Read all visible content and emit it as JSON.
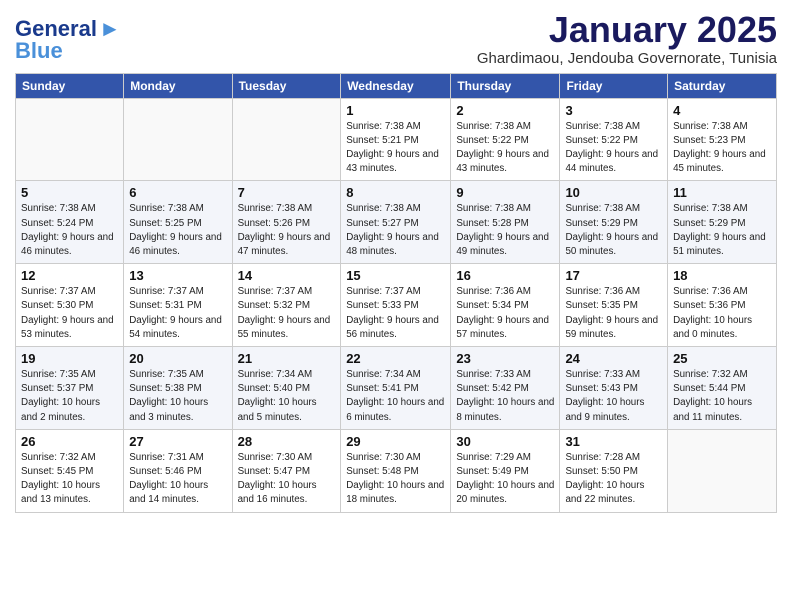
{
  "header": {
    "logo_line1": "General",
    "logo_line2": "Blue",
    "month": "January 2025",
    "location": "Ghardimaou, Jendouba Governorate, Tunisia"
  },
  "weekdays": [
    "Sunday",
    "Monday",
    "Tuesday",
    "Wednesday",
    "Thursday",
    "Friday",
    "Saturday"
  ],
  "weeks": [
    [
      {
        "day": "",
        "sunrise": "",
        "sunset": "",
        "daylight": ""
      },
      {
        "day": "",
        "sunrise": "",
        "sunset": "",
        "daylight": ""
      },
      {
        "day": "",
        "sunrise": "",
        "sunset": "",
        "daylight": ""
      },
      {
        "day": "1",
        "sunrise": "Sunrise: 7:38 AM",
        "sunset": "Sunset: 5:21 PM",
        "daylight": "Daylight: 9 hours and 43 minutes."
      },
      {
        "day": "2",
        "sunrise": "Sunrise: 7:38 AM",
        "sunset": "Sunset: 5:22 PM",
        "daylight": "Daylight: 9 hours and 43 minutes."
      },
      {
        "day": "3",
        "sunrise": "Sunrise: 7:38 AM",
        "sunset": "Sunset: 5:22 PM",
        "daylight": "Daylight: 9 hours and 44 minutes."
      },
      {
        "day": "4",
        "sunrise": "Sunrise: 7:38 AM",
        "sunset": "Sunset: 5:23 PM",
        "daylight": "Daylight: 9 hours and 45 minutes."
      }
    ],
    [
      {
        "day": "5",
        "sunrise": "Sunrise: 7:38 AM",
        "sunset": "Sunset: 5:24 PM",
        "daylight": "Daylight: 9 hours and 46 minutes."
      },
      {
        "day": "6",
        "sunrise": "Sunrise: 7:38 AM",
        "sunset": "Sunset: 5:25 PM",
        "daylight": "Daylight: 9 hours and 46 minutes."
      },
      {
        "day": "7",
        "sunrise": "Sunrise: 7:38 AM",
        "sunset": "Sunset: 5:26 PM",
        "daylight": "Daylight: 9 hours and 47 minutes."
      },
      {
        "day": "8",
        "sunrise": "Sunrise: 7:38 AM",
        "sunset": "Sunset: 5:27 PM",
        "daylight": "Daylight: 9 hours and 48 minutes."
      },
      {
        "day": "9",
        "sunrise": "Sunrise: 7:38 AM",
        "sunset": "Sunset: 5:28 PM",
        "daylight": "Daylight: 9 hours and 49 minutes."
      },
      {
        "day": "10",
        "sunrise": "Sunrise: 7:38 AM",
        "sunset": "Sunset: 5:29 PM",
        "daylight": "Daylight: 9 hours and 50 minutes."
      },
      {
        "day": "11",
        "sunrise": "Sunrise: 7:38 AM",
        "sunset": "Sunset: 5:29 PM",
        "daylight": "Daylight: 9 hours and 51 minutes."
      }
    ],
    [
      {
        "day": "12",
        "sunrise": "Sunrise: 7:37 AM",
        "sunset": "Sunset: 5:30 PM",
        "daylight": "Daylight: 9 hours and 53 minutes."
      },
      {
        "day": "13",
        "sunrise": "Sunrise: 7:37 AM",
        "sunset": "Sunset: 5:31 PM",
        "daylight": "Daylight: 9 hours and 54 minutes."
      },
      {
        "day": "14",
        "sunrise": "Sunrise: 7:37 AM",
        "sunset": "Sunset: 5:32 PM",
        "daylight": "Daylight: 9 hours and 55 minutes."
      },
      {
        "day": "15",
        "sunrise": "Sunrise: 7:37 AM",
        "sunset": "Sunset: 5:33 PM",
        "daylight": "Daylight: 9 hours and 56 minutes."
      },
      {
        "day": "16",
        "sunrise": "Sunrise: 7:36 AM",
        "sunset": "Sunset: 5:34 PM",
        "daylight": "Daylight: 9 hours and 57 minutes."
      },
      {
        "day": "17",
        "sunrise": "Sunrise: 7:36 AM",
        "sunset": "Sunset: 5:35 PM",
        "daylight": "Daylight: 9 hours and 59 minutes."
      },
      {
        "day": "18",
        "sunrise": "Sunrise: 7:36 AM",
        "sunset": "Sunset: 5:36 PM",
        "daylight": "Daylight: 10 hours and 0 minutes."
      }
    ],
    [
      {
        "day": "19",
        "sunrise": "Sunrise: 7:35 AM",
        "sunset": "Sunset: 5:37 PM",
        "daylight": "Daylight: 10 hours and 2 minutes."
      },
      {
        "day": "20",
        "sunrise": "Sunrise: 7:35 AM",
        "sunset": "Sunset: 5:38 PM",
        "daylight": "Daylight: 10 hours and 3 minutes."
      },
      {
        "day": "21",
        "sunrise": "Sunrise: 7:34 AM",
        "sunset": "Sunset: 5:40 PM",
        "daylight": "Daylight: 10 hours and 5 minutes."
      },
      {
        "day": "22",
        "sunrise": "Sunrise: 7:34 AM",
        "sunset": "Sunset: 5:41 PM",
        "daylight": "Daylight: 10 hours and 6 minutes."
      },
      {
        "day": "23",
        "sunrise": "Sunrise: 7:33 AM",
        "sunset": "Sunset: 5:42 PM",
        "daylight": "Daylight: 10 hours and 8 minutes."
      },
      {
        "day": "24",
        "sunrise": "Sunrise: 7:33 AM",
        "sunset": "Sunset: 5:43 PM",
        "daylight": "Daylight: 10 hours and 9 minutes."
      },
      {
        "day": "25",
        "sunrise": "Sunrise: 7:32 AM",
        "sunset": "Sunset: 5:44 PM",
        "daylight": "Daylight: 10 hours and 11 minutes."
      }
    ],
    [
      {
        "day": "26",
        "sunrise": "Sunrise: 7:32 AM",
        "sunset": "Sunset: 5:45 PM",
        "daylight": "Daylight: 10 hours and 13 minutes."
      },
      {
        "day": "27",
        "sunrise": "Sunrise: 7:31 AM",
        "sunset": "Sunset: 5:46 PM",
        "daylight": "Daylight: 10 hours and 14 minutes."
      },
      {
        "day": "28",
        "sunrise": "Sunrise: 7:30 AM",
        "sunset": "Sunset: 5:47 PM",
        "daylight": "Daylight: 10 hours and 16 minutes."
      },
      {
        "day": "29",
        "sunrise": "Sunrise: 7:30 AM",
        "sunset": "Sunset: 5:48 PM",
        "daylight": "Daylight: 10 hours and 18 minutes."
      },
      {
        "day": "30",
        "sunrise": "Sunrise: 7:29 AM",
        "sunset": "Sunset: 5:49 PM",
        "daylight": "Daylight: 10 hours and 20 minutes."
      },
      {
        "day": "31",
        "sunrise": "Sunrise: 7:28 AM",
        "sunset": "Sunset: 5:50 PM",
        "daylight": "Daylight: 10 hours and 22 minutes."
      },
      {
        "day": "",
        "sunrise": "",
        "sunset": "",
        "daylight": ""
      }
    ]
  ]
}
